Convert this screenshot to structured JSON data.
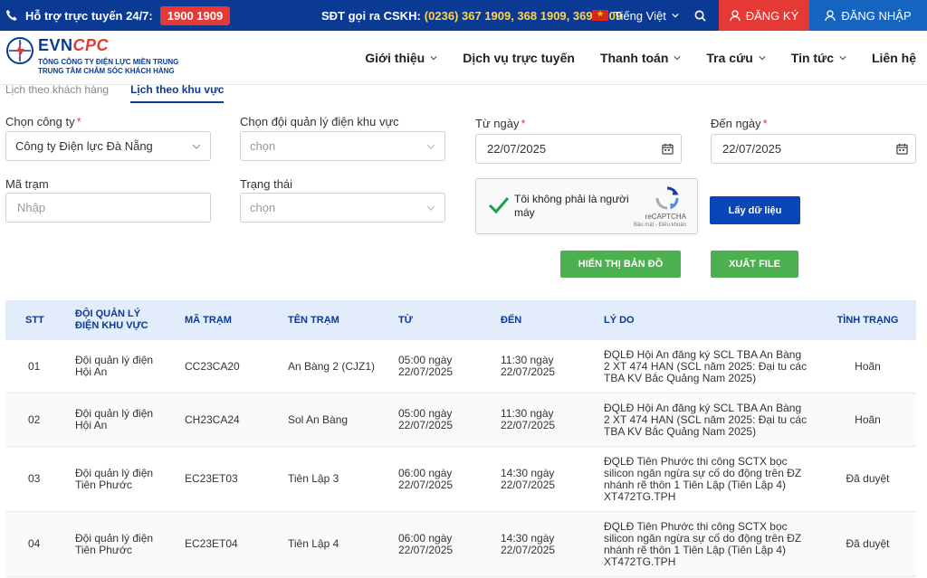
{
  "topbar": {
    "support_label": "Hỗ trợ trực tuyến 24/7:",
    "hotline": "1900 1909",
    "cskh_label": "SĐT gọi ra CSKH:",
    "cskh_phones": "(0236) 367 1909, 368 1909, 369 1909",
    "language": "Tiếng Việt",
    "register": "ĐĂNG KÝ",
    "login": "ĐĂNG NHẬP"
  },
  "logo": {
    "brand_evn": "EVN",
    "brand_cpc": "CPC",
    "line1": "TỔNG CÔNG TY ĐIỆN LỰC MIỀN TRUNG",
    "line2": "TRUNG TÂM CHĂM SÓC KHÁCH HÀNG"
  },
  "nav": [
    "Giới thiệu",
    "Dịch vụ trực tuyến",
    "Thanh toán",
    "Tra cứu",
    "Tin tức",
    "Liên hệ"
  ],
  "tabs": [
    "Lịch theo khách hàng",
    "Lịch theo khu vực"
  ],
  "form": {
    "company_label": "Chọn công ty",
    "company_value": "Công ty Điện lực Đà Nẵng",
    "team_label": "Chọn đội quản lý điện khu vực",
    "team_placeholder": "chọn",
    "from_label": "Từ ngày",
    "from_value": "22/07/2025",
    "to_label": "Đến ngày",
    "to_value": "22/07/2025",
    "station_label": "Mã trạm",
    "station_placeholder": "Nhập",
    "status_label": "Trạng thái",
    "status_placeholder": "chọn",
    "captcha_text": "Tôi không phải là người máy",
    "captcha_brand": "reCAPTCHA",
    "captcha_links": "Bảo mật - Điều khoản",
    "btn_get": "Lấy dữ liệu",
    "btn_map": "HIỂN THỊ BẢN ĐỒ",
    "btn_export": "XUẤT FILE"
  },
  "table": {
    "headers": [
      "STT",
      "ĐỘI QUẢN LÝ ĐIỆN KHU VỰC",
      "MÃ TRẠM",
      "TÊN TRẠM",
      "TỪ",
      "ĐẾN",
      "LÝ DO",
      "TÌNH TRẠNG"
    ],
    "rows": [
      [
        "01",
        "Đội quản lý điện Hội An",
        "CC23CA20",
        "An Bàng 2 (CJZ1)",
        "05:00 ngày 22/07/2025",
        "11:30 ngày 22/07/2025",
        "ĐQLĐ Hội An đăng ký SCL TBA An Bàng 2 XT 474 HAN (SCL năm 2025: Đại tu các TBA KV Bắc Quảng Nam 2025)",
        "Hoãn"
      ],
      [
        "02",
        "Đội quản lý điện Hội An",
        "CH23CA24",
        "Sol An Bàng",
        "05:00 ngày 22/07/2025",
        "11:30 ngày 22/07/2025",
        "ĐQLĐ Hội An đăng ký SCL TBA An Bàng 2 XT 474 HAN (SCL năm 2025: Đại tu các TBA KV Bắc Quảng Nam 2025)",
        "Hoãn"
      ],
      [
        "03",
        "Đội quản lý điện Tiên Phước",
        "EC23ET03",
        "Tiên Lập 3",
        "06:00 ngày 22/07/2025",
        "14:30 ngày 22/07/2025",
        "ĐQLĐ Tiên Phước thi công SCTX bọc silicon ngăn ngừa sự cố do động trên ĐZ nhánh rẽ thôn 1 Tiên Lập (Tiên Lập 4) XT472TG.TPH",
        "Đã duyệt"
      ],
      [
        "04",
        "Đội quản lý điện Tiên Phước",
        "EC23ET04",
        "Tiên Lập 4",
        "06:00 ngày 22/07/2025",
        "14:30 ngày 22/07/2025",
        "ĐQLĐ Tiên Phước thi công SCTX bọc silicon ngăn ngừa sự cố do động trên ĐZ nhánh rẽ thôn 1 Tiên Lập (Tiên Lập 4) XT472TG.TPH",
        "Đã duyệt"
      ]
    ]
  }
}
